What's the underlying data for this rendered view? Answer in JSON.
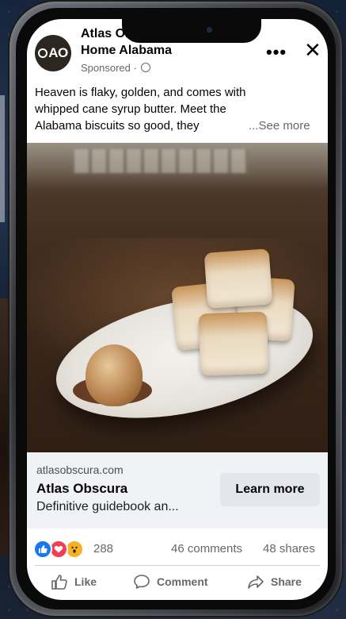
{
  "post": {
    "avatar_text": "AO",
    "page_name_line1": "Atlas Obscura",
    "page_name_line2": "Home Alabama",
    "sponsored": "Sponsored ·",
    "more_label": "•••",
    "close_label": "✕",
    "caption_line1": "Heaven is flaky, golden, and comes with",
    "caption_line2": "whipped cane syrup butter. Meet the",
    "caption_line3": "Alabama biscuits so good, they",
    "see_more": "...See more"
  },
  "image": {
    "description_icon": "biscuits-photo"
  },
  "link": {
    "domain": "atlasobscura.com",
    "title": "Atlas Obscura",
    "description": "Definitive guidebook an...",
    "cta": "Learn more"
  },
  "engagement": {
    "reactions": [
      "like",
      "love",
      "wow"
    ],
    "reaction_count": "288",
    "comments": "46 comments",
    "shares": "48 shares"
  },
  "actions": {
    "like": "Like",
    "comment": "Comment",
    "share": "Share"
  },
  "colors": {
    "like_blue": "#1877f2",
    "love_red": "#f33e58",
    "wow_yellow": "#f7b125",
    "secondary_text": "#65676b"
  }
}
